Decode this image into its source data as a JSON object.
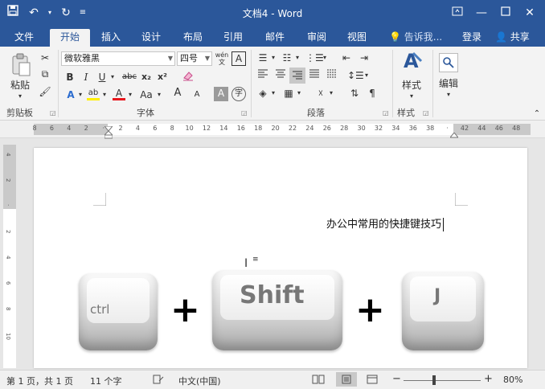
{
  "title_bar": {
    "title": "文档4 - Word",
    "icons": [
      "save-icon",
      "undo-icon",
      "redo-icon",
      "customize-qat-icon"
    ],
    "window_icons": [
      "ribbon-display-icon",
      "minimize-icon",
      "maximize-icon",
      "close-icon"
    ]
  },
  "tabs": [
    {
      "label": "文件"
    },
    {
      "label": "开始"
    },
    {
      "label": "插入"
    },
    {
      "label": "设计"
    },
    {
      "label": "布局"
    },
    {
      "label": "引用"
    },
    {
      "label": "邮件"
    },
    {
      "label": "审阅"
    },
    {
      "label": "视图"
    }
  ],
  "tell_me": "告诉我...",
  "login": "登录",
  "share": "共享",
  "ribbon": {
    "clipboard": {
      "paste_label": "粘贴",
      "group_label": "剪贴板"
    },
    "font": {
      "font_name": "微软雅黑",
      "font_size": "四号",
      "phonetic_glyph": "wén",
      "bold": "B",
      "italic": "I",
      "underline": "U",
      "strike": "abc",
      "subscript": "x₂",
      "superscript": "x²",
      "highlight": "ab",
      "font_color": "A",
      "case": "Aa",
      "grow": "A",
      "shrink": "A",
      "group_label": "字体"
    },
    "paragraph": {
      "group_label": "段落"
    },
    "styles": {
      "label": "样式",
      "group_label": "样式"
    },
    "editing": {
      "label": "编辑"
    }
  },
  "ruler": {
    "h_ticks": [
      "8",
      "6",
      "4",
      "2",
      "",
      "2",
      "4",
      "6",
      "8",
      "10",
      "12",
      "14",
      "16",
      "18",
      "20",
      "22",
      "24",
      "26",
      "28",
      "30",
      "32",
      "34",
      "36",
      "38",
      "",
      "42",
      "44",
      "46",
      "48"
    ],
    "v_ticks": [
      "4",
      "2",
      "",
      "2",
      "4",
      "6",
      "8",
      "10"
    ]
  },
  "document": {
    "text": "办公中常用的快捷键技巧",
    "keys": [
      {
        "label": "ctrl"
      },
      {
        "label": "Shift"
      },
      {
        "label": "J"
      }
    ],
    "plus": "+"
  },
  "status": {
    "page": "第 1 页，共 1 页",
    "words": "11 个字",
    "language": "中文(中国)",
    "zoom": "80%",
    "zoom_minus": "−",
    "zoom_plus": "+"
  }
}
